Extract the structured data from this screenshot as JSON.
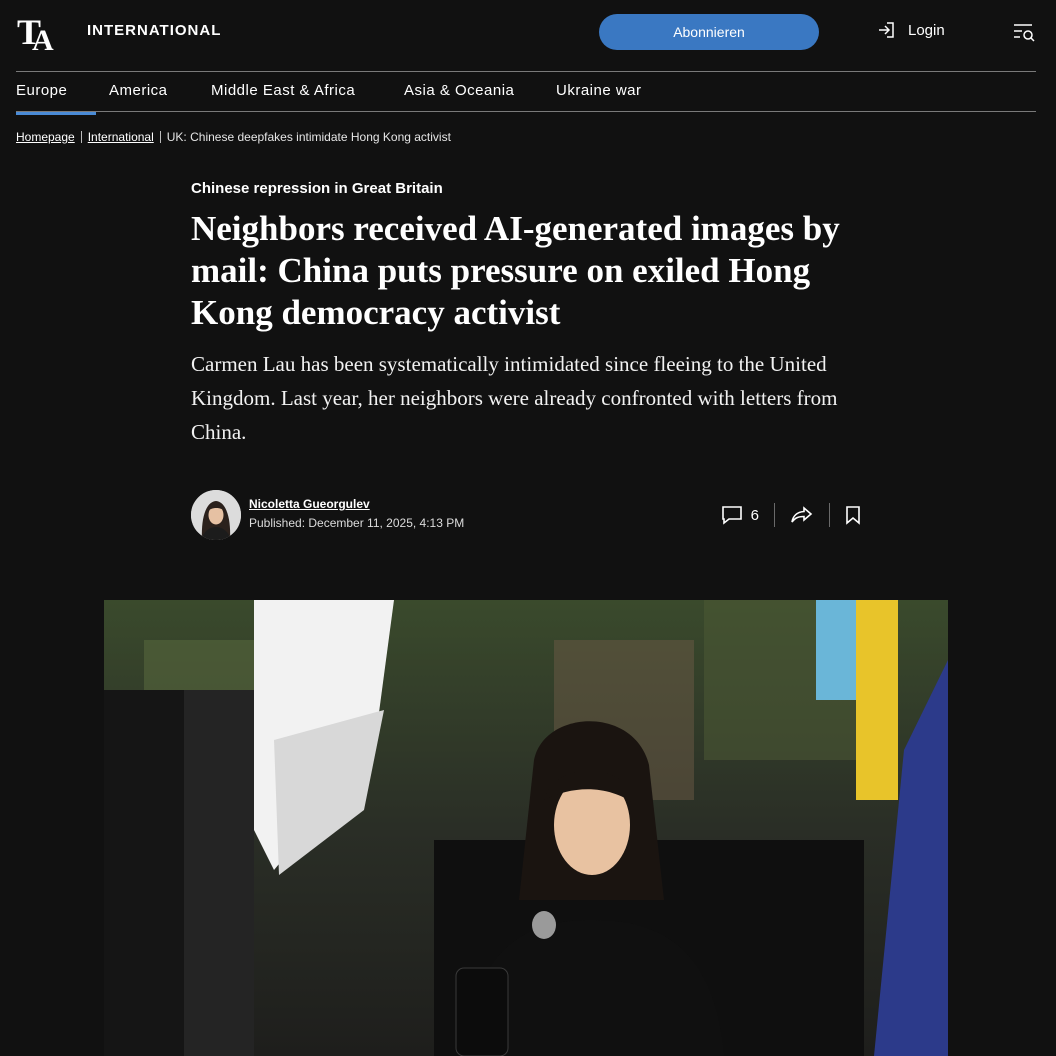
{
  "header": {
    "brand": "INTERNATIONAL",
    "subscribe_label": "Abonnieren",
    "login_label": "Login"
  },
  "nav": {
    "items": [
      "Europe",
      "America",
      "Middle East & Africa",
      "Asia & Oceania",
      "Ukraine war"
    ],
    "active": "Europe"
  },
  "breadcrumb": {
    "home": "Homepage",
    "section": "International",
    "current": "UK: Chinese deepfakes intimidate Hong Kong activist"
  },
  "article": {
    "kicker": "Chinese repression in Great Britain",
    "headline": "Neighbors received AI-generated images by mail: China puts pressure on exiled Hong Kong democracy activist",
    "lead": "Carmen Lau has been systematically intimidated since fleeing to the United Kingdom. Last year, her neighbors were already confronted with letters from China.",
    "author": "Nicoletta Gueorgulev",
    "published": "Published: December 11, 2025, 4:13 PM",
    "comment_count": "6"
  },
  "colors": {
    "background": "#111111",
    "accent": "#3a78c2",
    "nav_indicator": "#4a8bd6"
  },
  "icons": {
    "logo": "ta-logo-icon",
    "login": "login-icon",
    "menu": "menu-search-icon",
    "comment": "comment-icon",
    "share": "share-icon",
    "bookmark": "bookmark-icon"
  }
}
